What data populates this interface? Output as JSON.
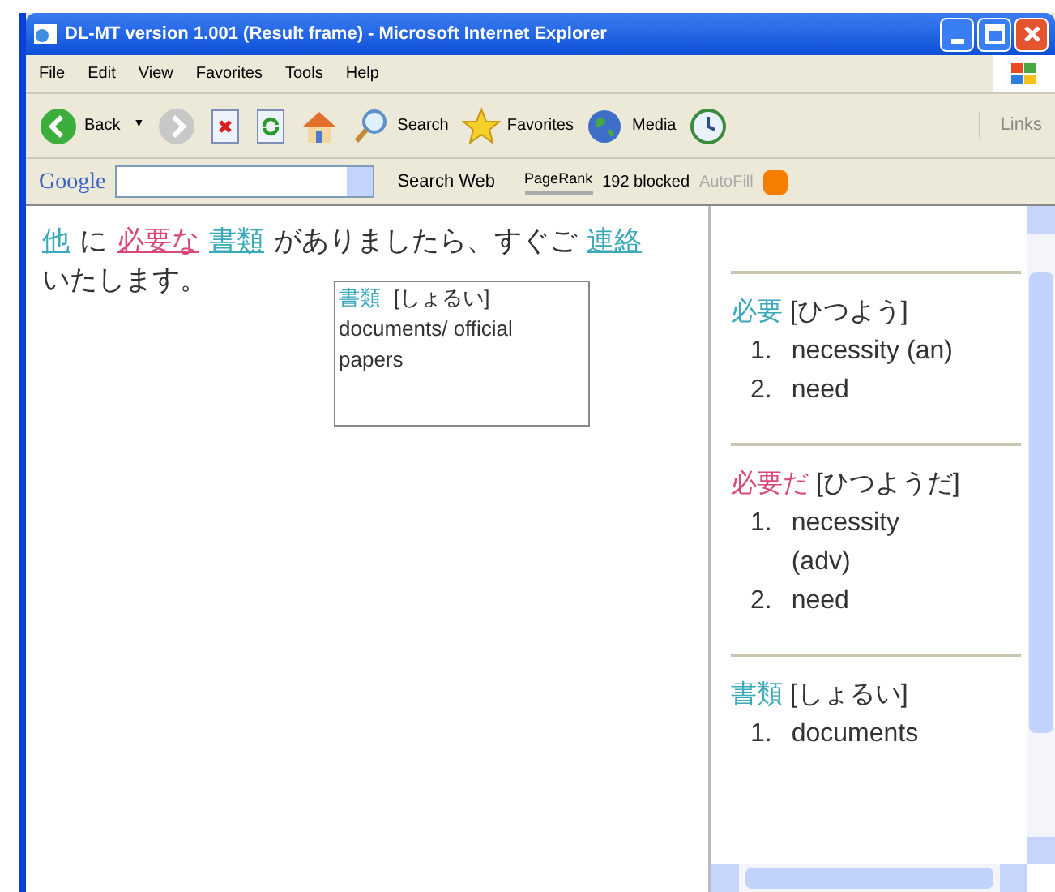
{
  "window": {
    "title": "DL-MT version 1.001 (Result frame) - Microsoft Internet Explorer"
  },
  "menu": [
    "File",
    "Edit",
    "View",
    "Favorites",
    "Tools",
    "Help"
  ],
  "toolbar": [
    {
      "kind": "back",
      "label": "Back",
      "dropdown": "▼"
    },
    {
      "kind": "forward"
    },
    {
      "kind": "stop"
    },
    {
      "kind": "refresh"
    },
    {
      "kind": "home"
    },
    {
      "kind": "search",
      "label": "Search"
    },
    {
      "kind": "favorites",
      "label": "Favorites"
    },
    {
      "kind": "media",
      "label": "Media"
    },
    {
      "kind": "history"
    }
  ],
  "links_label": "Links",
  "google_bar": {
    "logo": "Google",
    "search_button": "Search Web",
    "pagerank": "PageRank",
    "blocked": "192 blocked",
    "autofill": "AutoFill"
  },
  "sentence": [
    {
      "kind": "link",
      "text": "他",
      "color": "#3aa9b9"
    },
    {
      "kind": "plain",
      "text": "に"
    },
    {
      "kind": "link",
      "text": "必要な",
      "color": "#d9497a"
    },
    {
      "kind": "link",
      "text": "書類",
      "color": "#3aa9b9"
    },
    {
      "kind": "plain",
      "text": "がありましたら、すぐご"
    },
    {
      "kind": "link",
      "text": "連絡",
      "color": "#3aa9b9"
    },
    {
      "kind": "plain",
      "text": "いたします。"
    }
  ],
  "popup": {
    "headword": "書類",
    "reading": "[しょるい]",
    "gloss": "documents/ official papers"
  },
  "entries": [
    {
      "headword": "必要",
      "color": "#3aa9b9",
      "reading": "[ひつよう]",
      "senses": [
        {
          "number": "1.",
          "text": "necessity (an)"
        },
        {
          "number": "2.",
          "text": "need"
        }
      ]
    },
    {
      "headword": "必要だ",
      "color": "#d9497a",
      "reading": "[ひつようだ]",
      "senses": [
        {
          "number": "1.",
          "text": "necessity (adv)"
        },
        {
          "number": "2.",
          "text": "need"
        }
      ]
    },
    {
      "headword": "書類",
      "color": "#3aa9b9",
      "reading": "[しょるい]",
      "senses": [
        {
          "number": "1.",
          "text": "documents"
        }
      ]
    }
  ]
}
